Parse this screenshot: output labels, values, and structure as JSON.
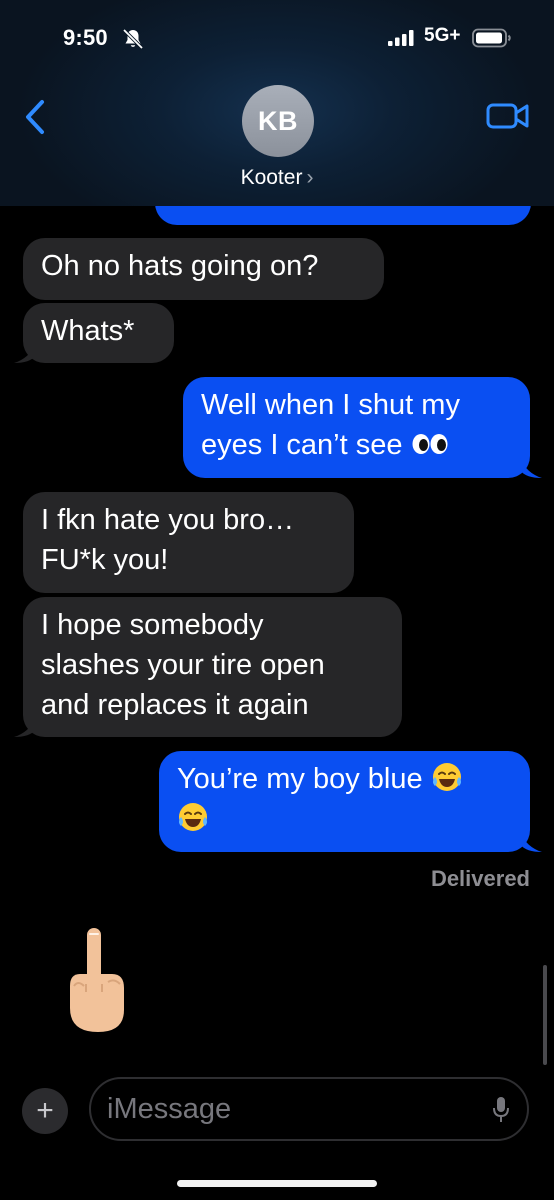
{
  "status_bar": {
    "time": "9:50",
    "network": "5G+",
    "icons": [
      "bell-slash-icon",
      "signal-icon",
      "battery-icon"
    ]
  },
  "header": {
    "avatar_initials": "KB",
    "contact_name": "Kooter",
    "icons": [
      "back-chevron-icon",
      "video-camera-icon"
    ]
  },
  "messages": [
    {
      "from": "them",
      "text": "Oh no hats going on?"
    },
    {
      "from": "them",
      "text": "Whats*"
    },
    {
      "from": "me",
      "line1": "Well when I shut my",
      "line2": "eyes I can’t see",
      "emoji": "eyes-emoji"
    },
    {
      "from": "them",
      "line1": "I fkn hate you bro…",
      "line2": "FU*k you!"
    },
    {
      "from": "them",
      "line1": "I hope somebody",
      "line2": "slashes your tire open",
      "line3": "and replaces it again"
    },
    {
      "from": "me",
      "line1": "You’re my boy blue",
      "emoji": "face-with-tears-of-joy-emoji"
    },
    {
      "from": "them",
      "sticker": "middle-finger-emoji"
    }
  ],
  "delivered_label": "Delivered",
  "composer": {
    "placeholder": "iMessage",
    "icons": [
      "plus-icon",
      "microphone-icon"
    ]
  },
  "colors": {
    "outgoing": "#0a4ff2",
    "incoming": "#262628",
    "accent": "#2f8bff",
    "background": "#000000"
  }
}
